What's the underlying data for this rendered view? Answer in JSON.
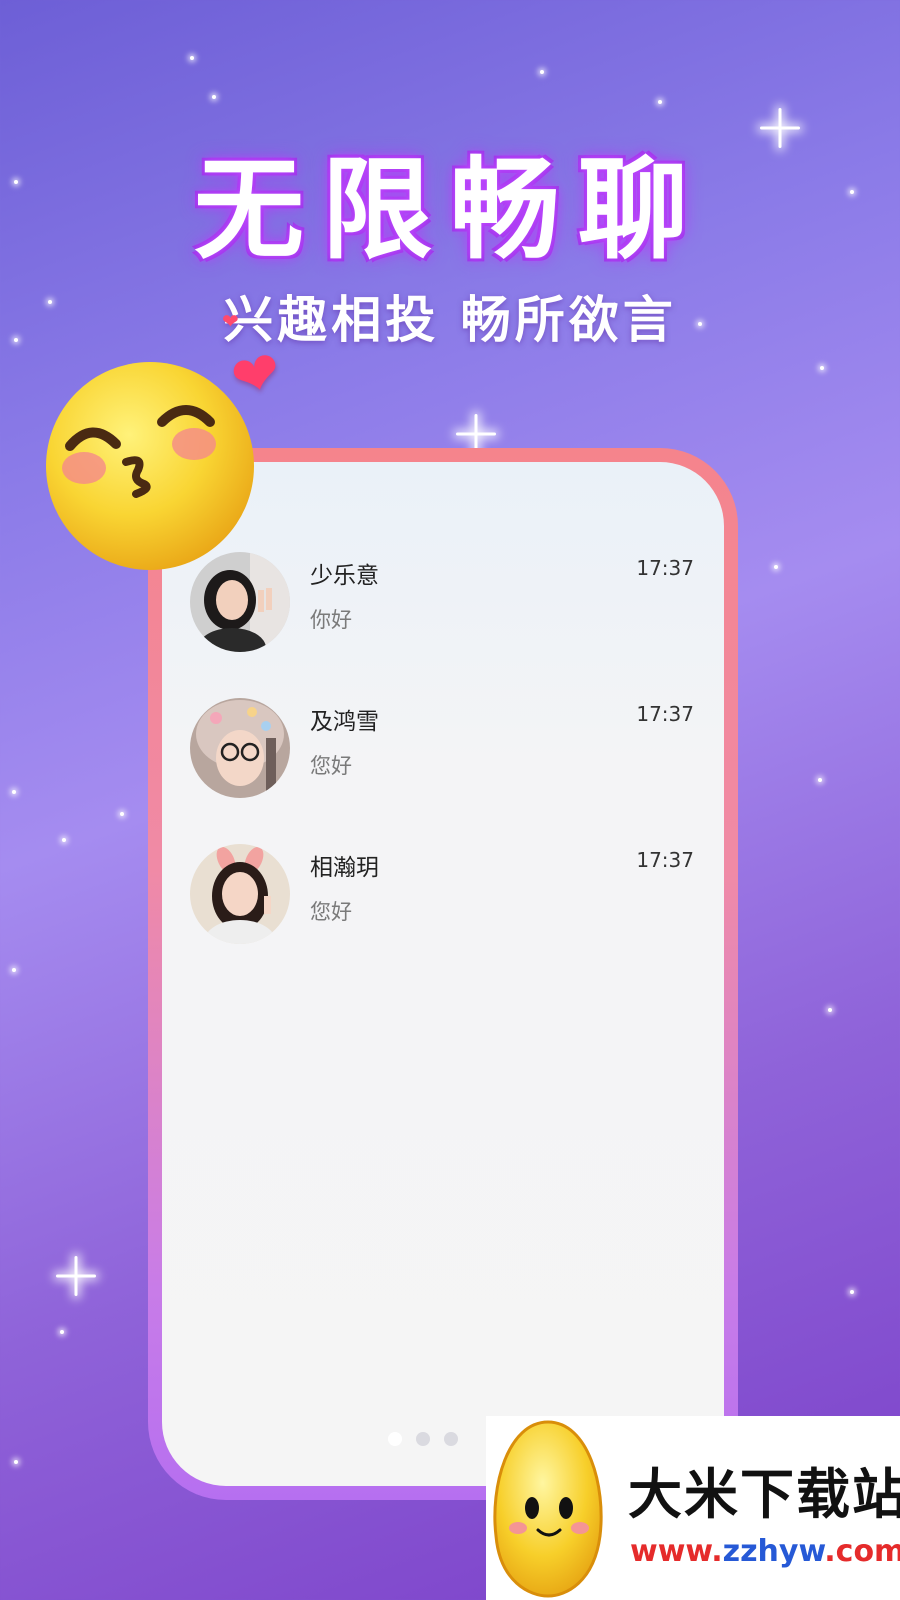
{
  "headline": "无限畅聊",
  "subline": "兴趣相投 畅所欲言",
  "chats": [
    {
      "name": "少乐意",
      "time": "17:37",
      "message": "你好"
    },
    {
      "name": "及鸿雪",
      "time": "17:37",
      "message": "您好"
    },
    {
      "name": "相瀚玥",
      "time": "17:37",
      "message": "您好"
    }
  ],
  "watermark": {
    "title": "大米下载站",
    "url_prefix": "www.",
    "url_domain": "zzhyw",
    "url_suffix": ".com"
  },
  "colors": {
    "frame": "#f5848c",
    "headline_glow": "#b13cf6",
    "url_red": "#e52b2b",
    "url_blue": "#2659d6"
  }
}
